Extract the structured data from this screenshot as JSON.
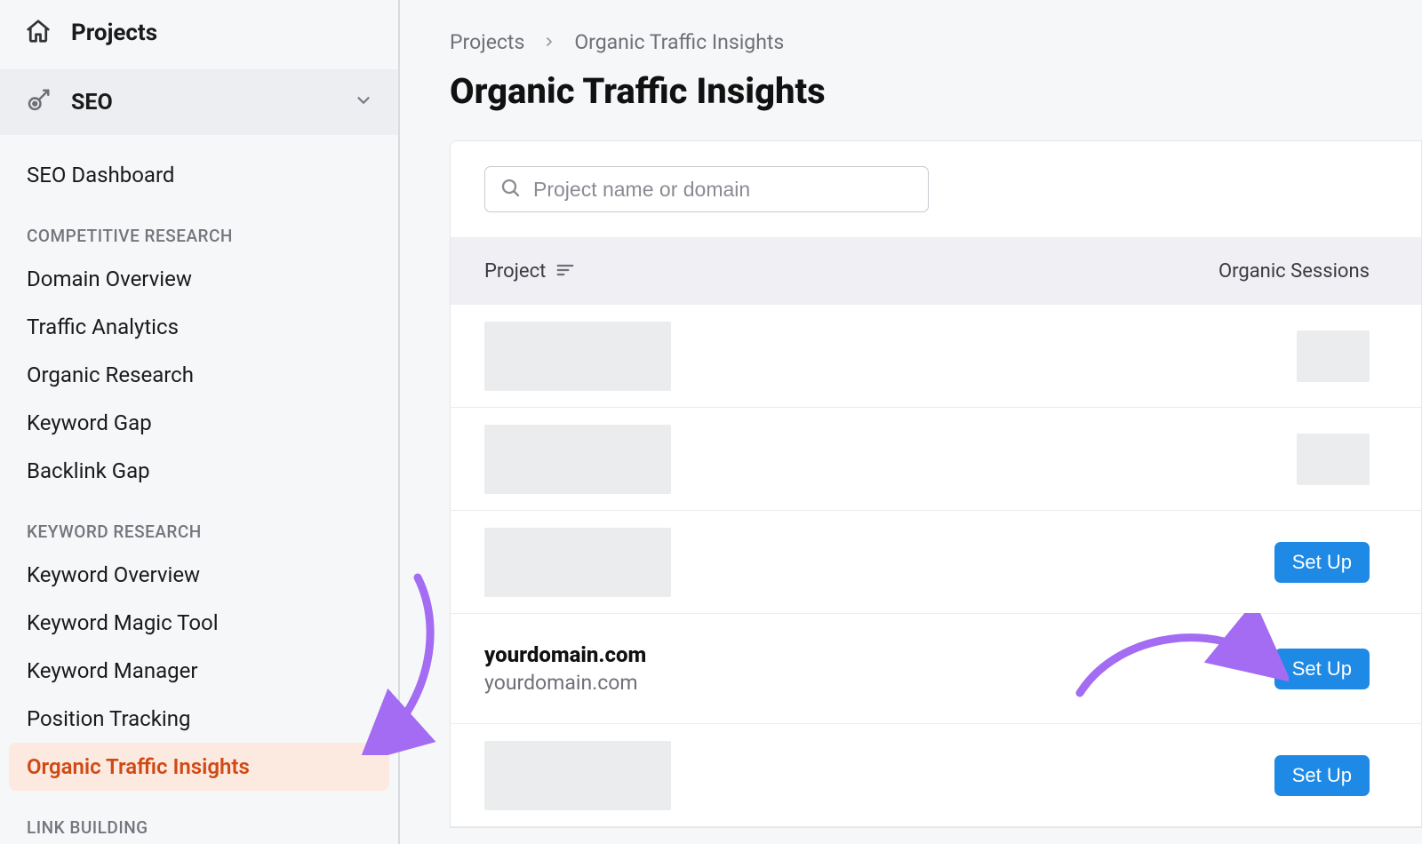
{
  "sidebar": {
    "projects_label": "Projects",
    "seo_label": "SEO",
    "items_top": [
      {
        "label": "SEO Dashboard"
      }
    ],
    "group_competitive": "COMPETITIVE RESEARCH",
    "items_competitive": [
      {
        "label": "Domain Overview"
      },
      {
        "label": "Traffic Analytics"
      },
      {
        "label": "Organic Research"
      },
      {
        "label": "Keyword Gap"
      },
      {
        "label": "Backlink Gap"
      }
    ],
    "group_keyword": "KEYWORD RESEARCH",
    "items_keyword": [
      {
        "label": "Keyword Overview"
      },
      {
        "label": "Keyword Magic Tool"
      },
      {
        "label": "Keyword Manager"
      },
      {
        "label": "Position Tracking"
      },
      {
        "label": "Organic Traffic Insights",
        "active": true
      }
    ],
    "group_link": "LINK BUILDING"
  },
  "breadcrumb": {
    "root": "Projects",
    "current": "Organic Traffic Insights"
  },
  "page_title": "Organic Traffic Insights",
  "search": {
    "placeholder": "Project name or domain"
  },
  "table": {
    "col_project": "Project",
    "col_sessions": "Organic Sessions",
    "rows": [
      {
        "type": "placeholder",
        "right": "placeholder"
      },
      {
        "type": "placeholder",
        "right": "placeholder"
      },
      {
        "type": "placeholder",
        "right": "setup"
      },
      {
        "type": "project",
        "name": "yourdomain.com",
        "domain": "yourdomain.com",
        "right": "setup"
      },
      {
        "type": "placeholder",
        "right": "setup"
      }
    ],
    "setup_label": "Set Up"
  }
}
